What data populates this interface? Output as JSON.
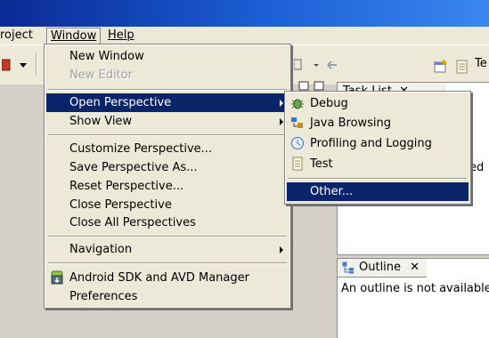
{
  "menubar": {
    "project_label": "roject",
    "window_label": "Window",
    "help_label": "Help"
  },
  "window_menu": {
    "new_window": "New Window",
    "new_editor": "New Editor",
    "open_perspective": "Open Perspective",
    "show_view": "Show View",
    "customize_perspective": "Customize Perspective...",
    "save_perspective_as": "Save Perspective As...",
    "reset_perspective": "Reset Perspective...",
    "close_perspective": "Close Perspective",
    "close_all_perspectives": "Close All Perspectives",
    "navigation": "Navigation",
    "android_sdk": "Android SDK and AVD Manager",
    "preferences": "Preferences"
  },
  "perspective_submenu": {
    "debug": "Debug",
    "java_browsing": "Java Browsing",
    "profiling": "Profiling and Logging",
    "test": "Test",
    "other": "Other..."
  },
  "views": {
    "task_list_tab": "Task List",
    "task_list_partial": "ed",
    "outline_tab": "Outline",
    "outline_message": "An outline is not available"
  },
  "toolbar": {
    "perspective_partial": "Te"
  },
  "icons": {
    "debug": "debug-bug-icon",
    "java_browsing": "java-browsing-icon",
    "profiling": "profiling-clock-icon",
    "test": "test-page-icon",
    "android": "android-sdk-icon",
    "outline": "outline-icon"
  },
  "colors": {
    "menu_highlight": "#0a246a",
    "menu_bg": "#ece9d8",
    "titlebar": "#1c5fd6"
  }
}
